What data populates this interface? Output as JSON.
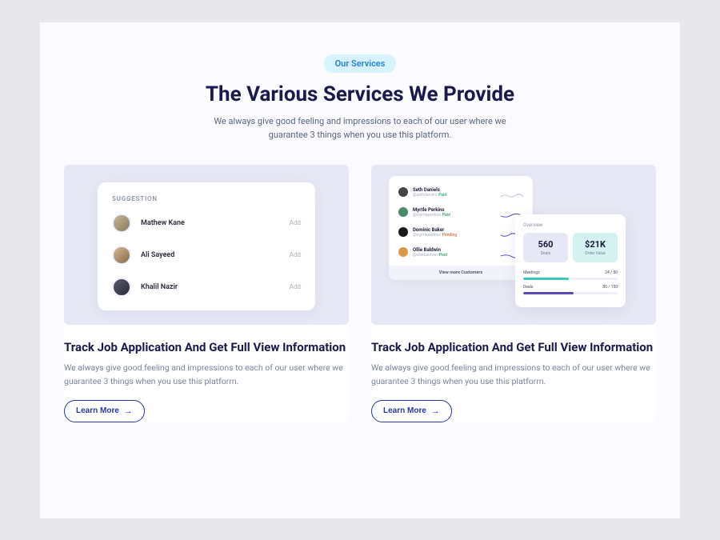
{
  "header": {
    "badge": "Our Services",
    "title": "The Various Services We Provide",
    "subtitle": "We always give good feeling and impressions to each of our user where we guarantee 3 things when you use this platform."
  },
  "cards": [
    {
      "title": "Track Job Application And Get Full View Information",
      "desc": "We always give good feeling and impressions to each of our user where we guarantee 3 things when you use this platform.",
      "learn_more": "Learn More"
    },
    {
      "title": "Track Job Application And Get Full View Information",
      "desc": "We always give good feeling and impressions to each of our user where we guarantee 3 things when you use this platform.",
      "learn_more": "Learn More"
    }
  ],
  "suggestion": {
    "header": "SUGGESTION",
    "add_label": "Add",
    "people": [
      {
        "name": "Mathew Kane"
      },
      {
        "name": "Ali Sayeed"
      },
      {
        "name": "Khalil Nazir"
      }
    ]
  },
  "customers": {
    "list": [
      {
        "name": "Seth Daniels",
        "handle": "@sethdaniels",
        "status": "Paid",
        "status_type": "paid"
      },
      {
        "name": "Myrtle Perkins",
        "handle": "@myrtleperkins",
        "status": "Paid",
        "status_type": "paid"
      },
      {
        "name": "Dominic Baker",
        "handle": "@myrtleperkins",
        "status": "Pending",
        "status_type": "pend"
      },
      {
        "name": "Ollie Baldwin",
        "handle": "@olliebaldwin",
        "status": "Paid",
        "status_type": "paid"
      }
    ],
    "view_more": "View more Customers"
  },
  "overview": {
    "title": "Overview",
    "stats": {
      "deals": {
        "value": "560",
        "label": "Deals"
      },
      "order_value": {
        "value": "$21K",
        "label": "Order Value"
      }
    },
    "metrics": [
      {
        "label": "Meetings",
        "value": "24 / 50"
      },
      {
        "label": "Deals",
        "value": "80 / 150"
      }
    ]
  }
}
